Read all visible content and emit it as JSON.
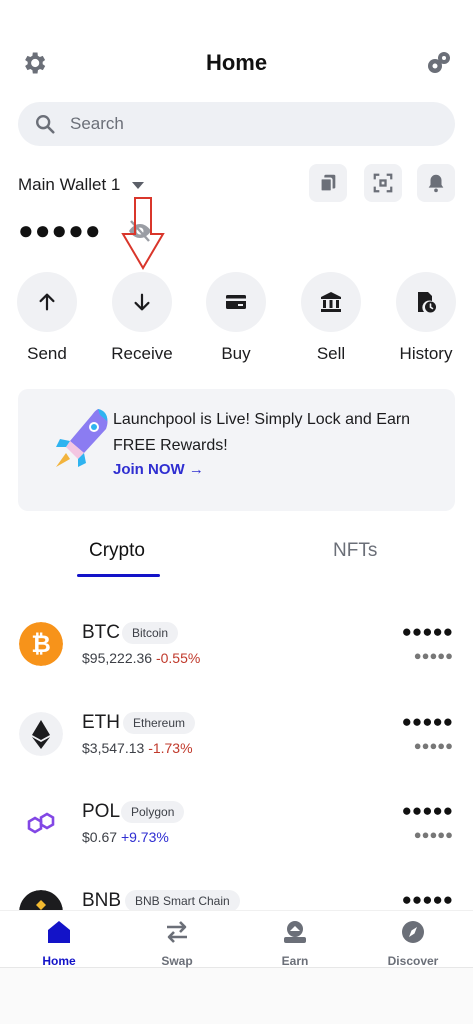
{
  "header": {
    "title": "Home",
    "left_icon": "gear-icon",
    "right_icon": "coins-icon"
  },
  "search": {
    "placeholder": "Search"
  },
  "wallet": {
    "name": "Main Wallet 1",
    "balance_masked": "●●●●●",
    "buttons": [
      "copy-icon",
      "scan-icon",
      "bell-icon"
    ]
  },
  "actions": [
    {
      "label": "Send",
      "icon": "arrow-up-icon"
    },
    {
      "label": "Receive",
      "icon": "arrow-down-icon"
    },
    {
      "label": "Buy",
      "icon": "card-icon"
    },
    {
      "label": "Sell",
      "icon": "bank-icon"
    },
    {
      "label": "History",
      "icon": "history-icon"
    }
  ],
  "banner": {
    "text": "Launchpool is Live! Simply Lock and Earn FREE Rewards!",
    "link": "Join NOW →"
  },
  "tabs": [
    {
      "label": "Crypto",
      "active": true
    },
    {
      "label": "NFTs",
      "active": false
    }
  ],
  "assets": [
    {
      "symbol": "BTC",
      "name": "Bitcoin",
      "price": "$95,222.36",
      "change": "-0.55%",
      "amount": "●●●●●",
      "value": "●●●●●"
    },
    {
      "symbol": "ETH",
      "name": "Ethereum",
      "price": "$3,547.13",
      "change": "-1.73%",
      "amount": "●●●●●",
      "value": "●●●●●"
    },
    {
      "symbol": "POL",
      "name": "Polygon",
      "price": "$0.67",
      "change": "+9.73%",
      "amount": "●●●●●",
      "value": "●●●●●"
    },
    {
      "symbol": "BNB",
      "name": "BNB Smart Chain",
      "price": "",
      "change": "",
      "amount": "●●●●●",
      "value": ""
    }
  ],
  "nav": [
    {
      "label": "Home",
      "active": true
    },
    {
      "label": "Swap",
      "active": false
    },
    {
      "label": "Earn",
      "active": false
    },
    {
      "label": "Discover",
      "active": false
    }
  ],
  "colors": {
    "accent": "#1313c8",
    "negative": "#c0392b",
    "positive": "#2f2ed1",
    "chip_bg": "#f0f1f4"
  }
}
